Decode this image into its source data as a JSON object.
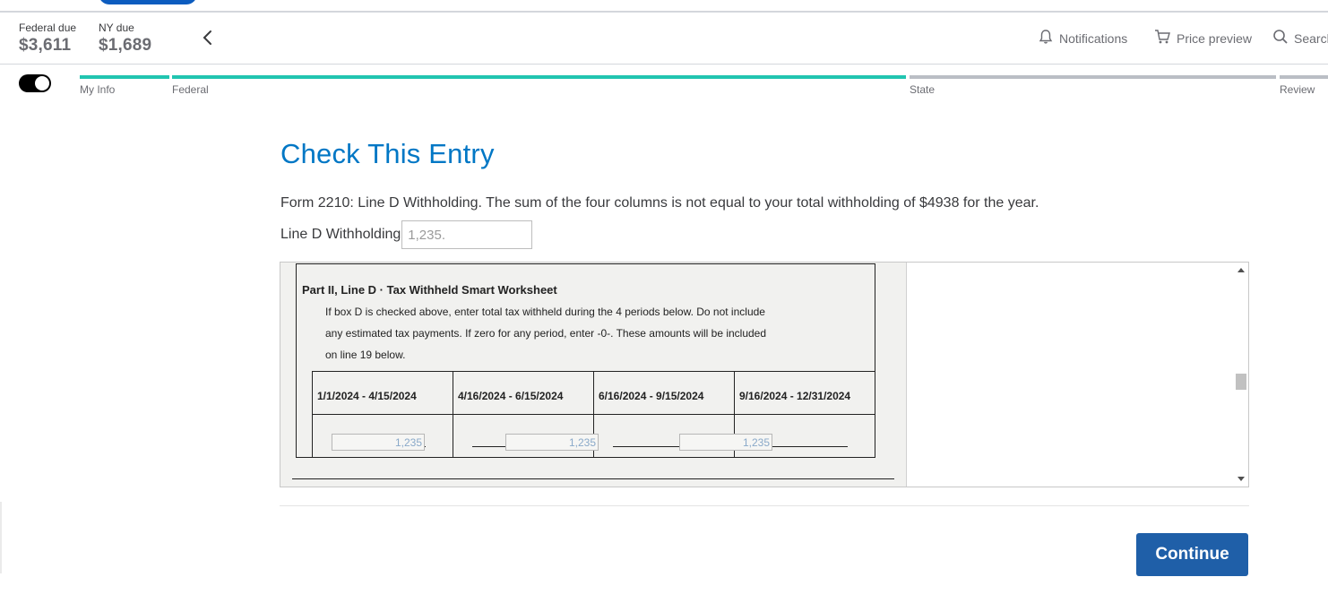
{
  "header": {
    "federal_due_label": "Federal due",
    "federal_due_amount": "$3,611",
    "ny_due_label": "NY due",
    "ny_due_amount": "$1,689",
    "back_icon": "chevron-left-icon",
    "links": {
      "notifications": "Notifications",
      "price_preview": "Price preview",
      "search": "Search"
    }
  },
  "progress": {
    "steps": [
      {
        "label": "My Info",
        "status": "complete"
      },
      {
        "label": "Federal",
        "status": "complete"
      },
      {
        "label": "State",
        "status": "incomplete"
      },
      {
        "label": "Review",
        "status": "incomplete"
      }
    ],
    "complete_color": "#21c5b0",
    "incomplete_color": "#babec5"
  },
  "main": {
    "title": "Check This Entry",
    "message": "Form 2210: Line D Withholding. The sum of the four columns is not equal to your total withholding of $4938 for the year.",
    "field_label": "Line D Withholding",
    "field_value": "1,235."
  },
  "worksheet": {
    "title": "Part II, Line D · Tax Withheld Smart Worksheet",
    "description_lines": [
      "If box D is checked above, enter total tax withheld during the 4 periods below. Do not include",
      "any estimated tax payments. If zero for any period, enter -0-. These amounts will be included",
      "on line 19 below."
    ],
    "columns": [
      {
        "header": "1/1/2024 - 4/15/2024",
        "value": "1,235"
      },
      {
        "header": "4/16/2024 - 6/15/2024",
        "value": "1,235"
      },
      {
        "header": "6/16/2024 - 9/15/2024",
        "value": "1,235"
      },
      {
        "header": "9/16/2024 - 12/31/2024",
        "value": ""
      }
    ]
  },
  "actions": {
    "continue_label": "Continue"
  },
  "colors": {
    "accent": "#0077c5",
    "button": "#1f5fa8"
  }
}
